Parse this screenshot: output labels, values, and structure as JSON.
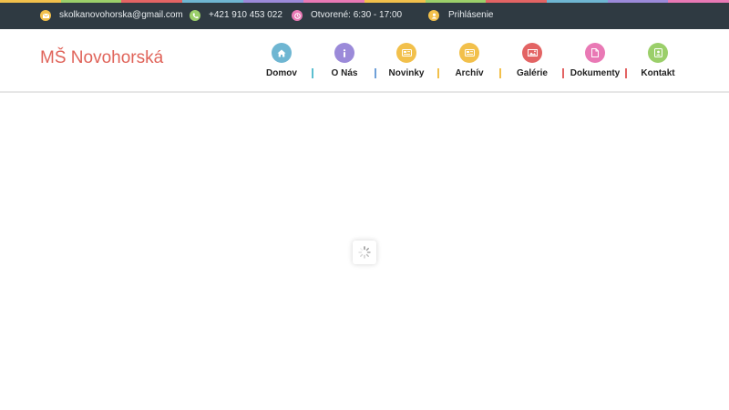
{
  "topbar": {
    "email": "skolkanovohorska@gmail.com",
    "phone": "+421 910 453 022",
    "hours": "Otvorené: 6:30 - 17:00",
    "login": "Prihlásenie"
  },
  "site": {
    "title": "MŠ Novohorská"
  },
  "nav": {
    "items": [
      {
        "label": "Domov",
        "icon": "home-icon",
        "color": "#6fb6d2"
      },
      {
        "label": "O Nás",
        "icon": "info-icon",
        "color": "#9b8ad9"
      },
      {
        "label": "Novinky",
        "icon": "news-icon",
        "color": "#f2c04b"
      },
      {
        "label": "Archív",
        "icon": "archive-icon",
        "color": "#f2c04b"
      },
      {
        "label": "Galérie",
        "icon": "gallery-icon",
        "color": "#e36464"
      },
      {
        "label": "Dokumenty",
        "icon": "document-icon",
        "color": "#e979b5"
      },
      {
        "label": "Kontakt",
        "icon": "contact-icon",
        "color": "#9bcf6a"
      }
    ],
    "separator_colors": [
      "#5bbfd0",
      "#6fa0d8",
      "#f2c04b",
      "#f2c04b",
      "#e36464",
      "#e36464"
    ]
  },
  "colors": {
    "topbar_bg": "#2f3a42",
    "logo": "#e0645a",
    "email_icon": "#f2c04b",
    "phone_icon": "#9bcf6a",
    "hours_icon": "#e979b5",
    "login_icon": "#f2c04b"
  }
}
